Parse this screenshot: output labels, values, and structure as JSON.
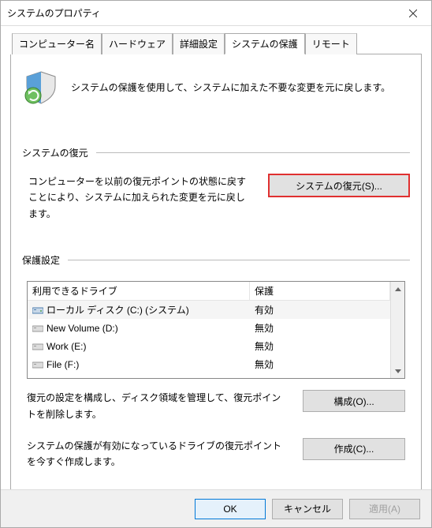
{
  "window": {
    "title": "システムのプロパティ"
  },
  "tabs": {
    "computer_name": "コンピューター名",
    "hardware": "ハードウェア",
    "advanced": "詳細設定",
    "protection": "システムの保護",
    "remote": "リモート"
  },
  "intro": {
    "text": "システムの保護を使用して、システムに加えた不要な変更を元に戻します。"
  },
  "restore_section": {
    "title": "システムの復元",
    "description": "コンピューターを以前の復元ポイントの状態に戻すことにより、システムに加えられた変更を元に戻します。",
    "button": "システムの復元(S)..."
  },
  "protection_section": {
    "title": "保護設定",
    "header_drive": "利用できるドライブ",
    "header_protection": "保護",
    "drives": [
      {
        "name": "ローカル ディスク (C:) (システム)",
        "status": "有効",
        "system": true
      },
      {
        "name": "New Volume (D:)",
        "status": "無効",
        "system": false
      },
      {
        "name": "Work (E:)",
        "status": "無効",
        "system": false
      },
      {
        "name": "File (F:)",
        "status": "無効",
        "system": false
      }
    ],
    "configure_text": "復元の設定を構成し、ディスク領域を管理して、復元ポイントを削除します。",
    "configure_button": "構成(O)...",
    "create_text": "システムの保護が有効になっているドライブの復元ポイントを今すぐ作成します。",
    "create_button": "作成(C)..."
  },
  "buttons": {
    "ok": "OK",
    "cancel": "キャンセル",
    "apply": "適用(A)"
  }
}
